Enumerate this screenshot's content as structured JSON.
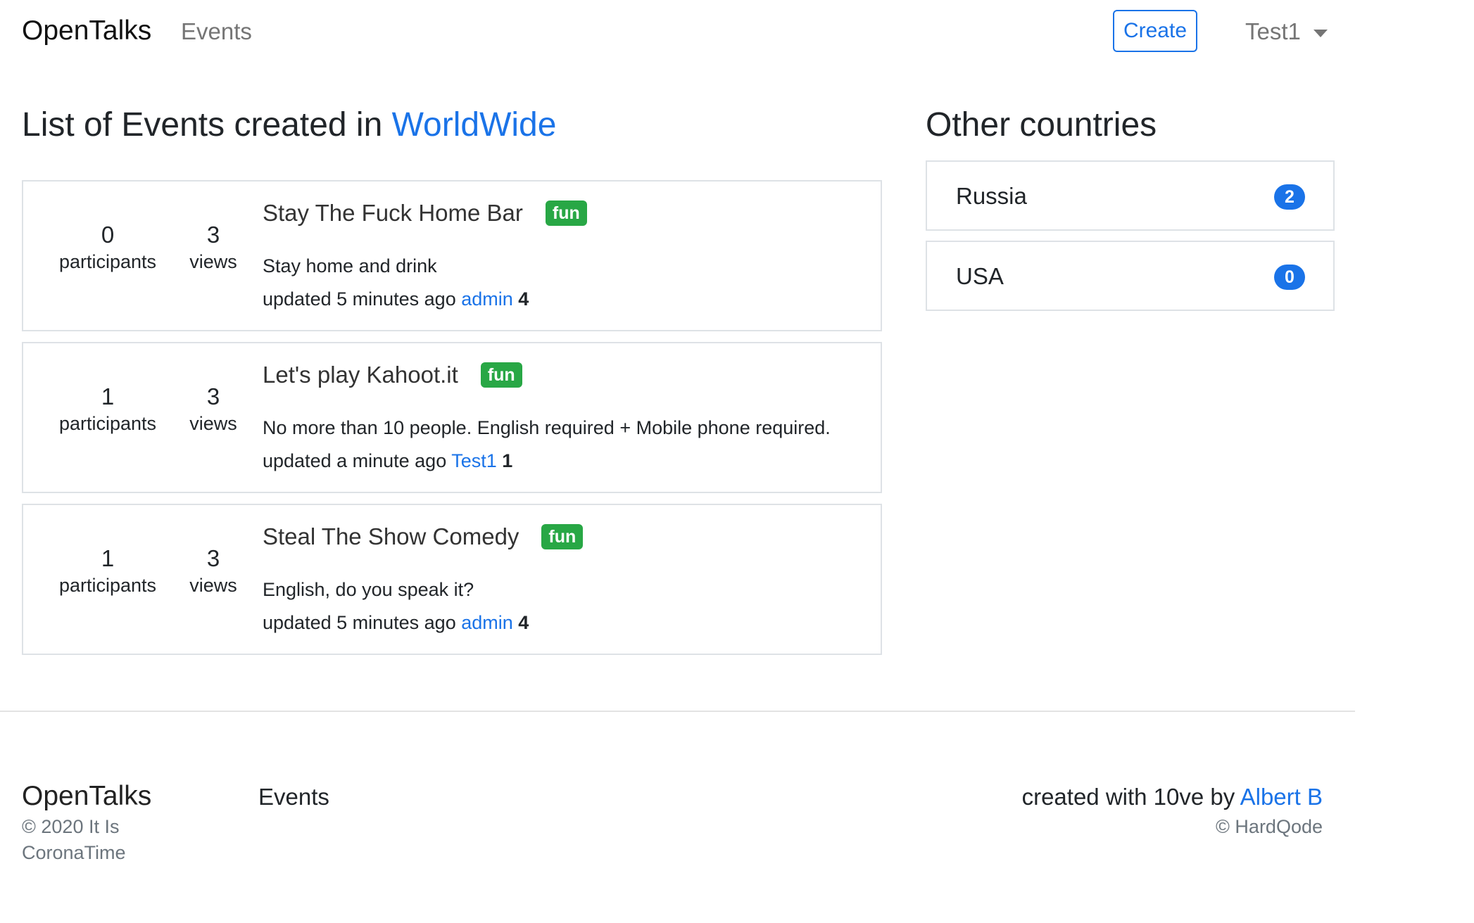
{
  "nav": {
    "brand": "OpenTalks",
    "events_link": "Events",
    "create_button": "Create",
    "user_menu": "Test1"
  },
  "main": {
    "title_prefix": "List of Events created in ",
    "title_location": "WorldWide",
    "events": [
      {
        "participants": "0",
        "participants_label": "participants",
        "views": "3",
        "views_label": "views",
        "title": "Stay The Fuck Home Bar",
        "badge": "fun",
        "description": "Stay home and drink",
        "updated": "updated 5 minutes ago",
        "author": "admin",
        "author_score": "4"
      },
      {
        "participants": "1",
        "participants_label": "participants",
        "views": "3",
        "views_label": "views",
        "title": "Let's play Kahoot.it",
        "badge": "fun",
        "description": "No more than 10 people. English required + Mobile phone required.",
        "updated": "updated a minute ago",
        "author": "Test1",
        "author_score": "1"
      },
      {
        "participants": "1",
        "participants_label": "participants",
        "views": "3",
        "views_label": "views",
        "title": "Steal The Show Comedy",
        "badge": "fun",
        "description": "English, do you speak it?",
        "updated": "updated 5 minutes ago",
        "author": "admin",
        "author_score": "4"
      }
    ]
  },
  "sidebar": {
    "title": "Other countries",
    "countries": [
      {
        "name": "Russia",
        "count": "2"
      },
      {
        "name": "USA",
        "count": "0"
      }
    ]
  },
  "footer": {
    "brand": "OpenTalks",
    "copyright_line1": "© 2020 It Is",
    "copyright_line2": "CoronaTime",
    "events_link": "Events",
    "created_with": "created with 10ve by ",
    "creator_link": "Albert B",
    "company": "© HardQode"
  },
  "colors": {
    "accent": "#1a73e8",
    "badge_green": "#28a745",
    "border": "#dee2e6"
  }
}
